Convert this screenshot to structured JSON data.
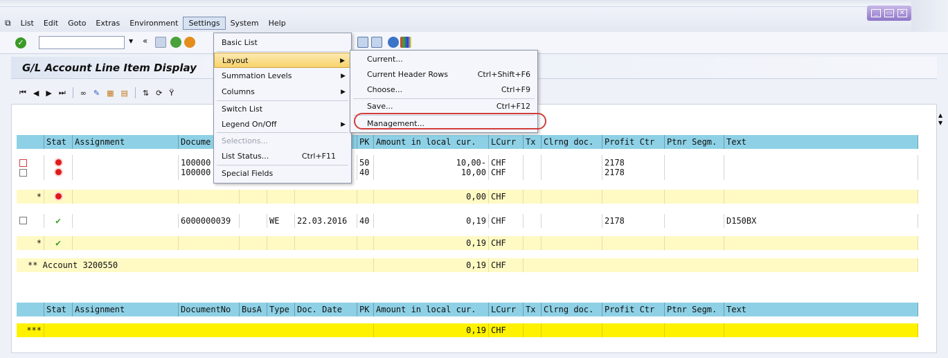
{
  "menubar": {
    "items": [
      "List",
      "Edit",
      "Goto",
      "Extras",
      "Environment",
      "Settings",
      "System",
      "Help"
    ],
    "active": "Settings"
  },
  "screen": {
    "title": "G/L Account Line Item Display"
  },
  "table": {
    "headers": {
      "stat": "Stat",
      "assignment": "Assignment",
      "document": "DocumentNo",
      "busa": "BusA",
      "type": "Type",
      "docdate": "Doc. Date",
      "pk": "PK",
      "amount": "Amount in local cur.",
      "lcurr": "LCurr",
      "tx": "Tx",
      "clrng": "Clrng doc.",
      "profit": "Profit Ctr",
      "ptnr": "Ptnr Segm.",
      "text": "Text"
    },
    "header_visible_doc": "Docume",
    "rows": {
      "r1": {
        "document": "100000",
        "pk": "50",
        "amount": "10,00-",
        "lcurr": "CHF",
        "profit": "2178"
      },
      "r2": {
        "document": "100000",
        "pk": "40",
        "amount": "10,00",
        "lcurr": "CHF",
        "profit": "2178"
      },
      "sub1": {
        "marker": "*",
        "amount": "0,00",
        "lcurr": "CHF"
      },
      "r3": {
        "document": "6000000039",
        "type": "WE",
        "docdate": "22.03.2016",
        "pk": "40",
        "amount": "0,19",
        "lcurr": "CHF",
        "profit": "2178",
        "text": "D150BX"
      },
      "sub2": {
        "marker": "*",
        "amount": "0,19",
        "lcurr": "CHF"
      },
      "acct": {
        "label": "** Account 3200550",
        "amount": "0,19",
        "lcurr": "CHF"
      },
      "grand": {
        "marker": "***",
        "amount": "0,19",
        "lcurr": "CHF"
      }
    }
  },
  "settings_menu": {
    "items": [
      {
        "label": "Basic List"
      },
      {
        "label": "Layout"
      },
      {
        "label": "Summation Levels"
      },
      {
        "label": "Columns"
      },
      {
        "label": "Switch List"
      },
      {
        "label": "Legend On/Off"
      },
      {
        "label": "Selections..."
      },
      {
        "label": "List Status...",
        "shortcut": "Ctrl+F11"
      },
      {
        "label": "Special Fields"
      }
    ]
  },
  "layout_submenu": {
    "items": [
      {
        "label": "Current...",
        "shortcut": ""
      },
      {
        "label": "Current Header Rows",
        "shortcut": "Ctrl+Shift+F6"
      },
      {
        "label": "Choose...",
        "shortcut": "Ctrl+F9"
      },
      {
        "label": "Save...",
        "shortcut": "Ctrl+F12"
      },
      {
        "label": "Management...",
        "shortcut": ""
      }
    ]
  },
  "colors": {
    "header_bg": "#8ed1e6",
    "subtotal_bg": "#fff9c4",
    "grandtotal_bg": "#fff200",
    "highlight_circle": "#d23b3b"
  }
}
